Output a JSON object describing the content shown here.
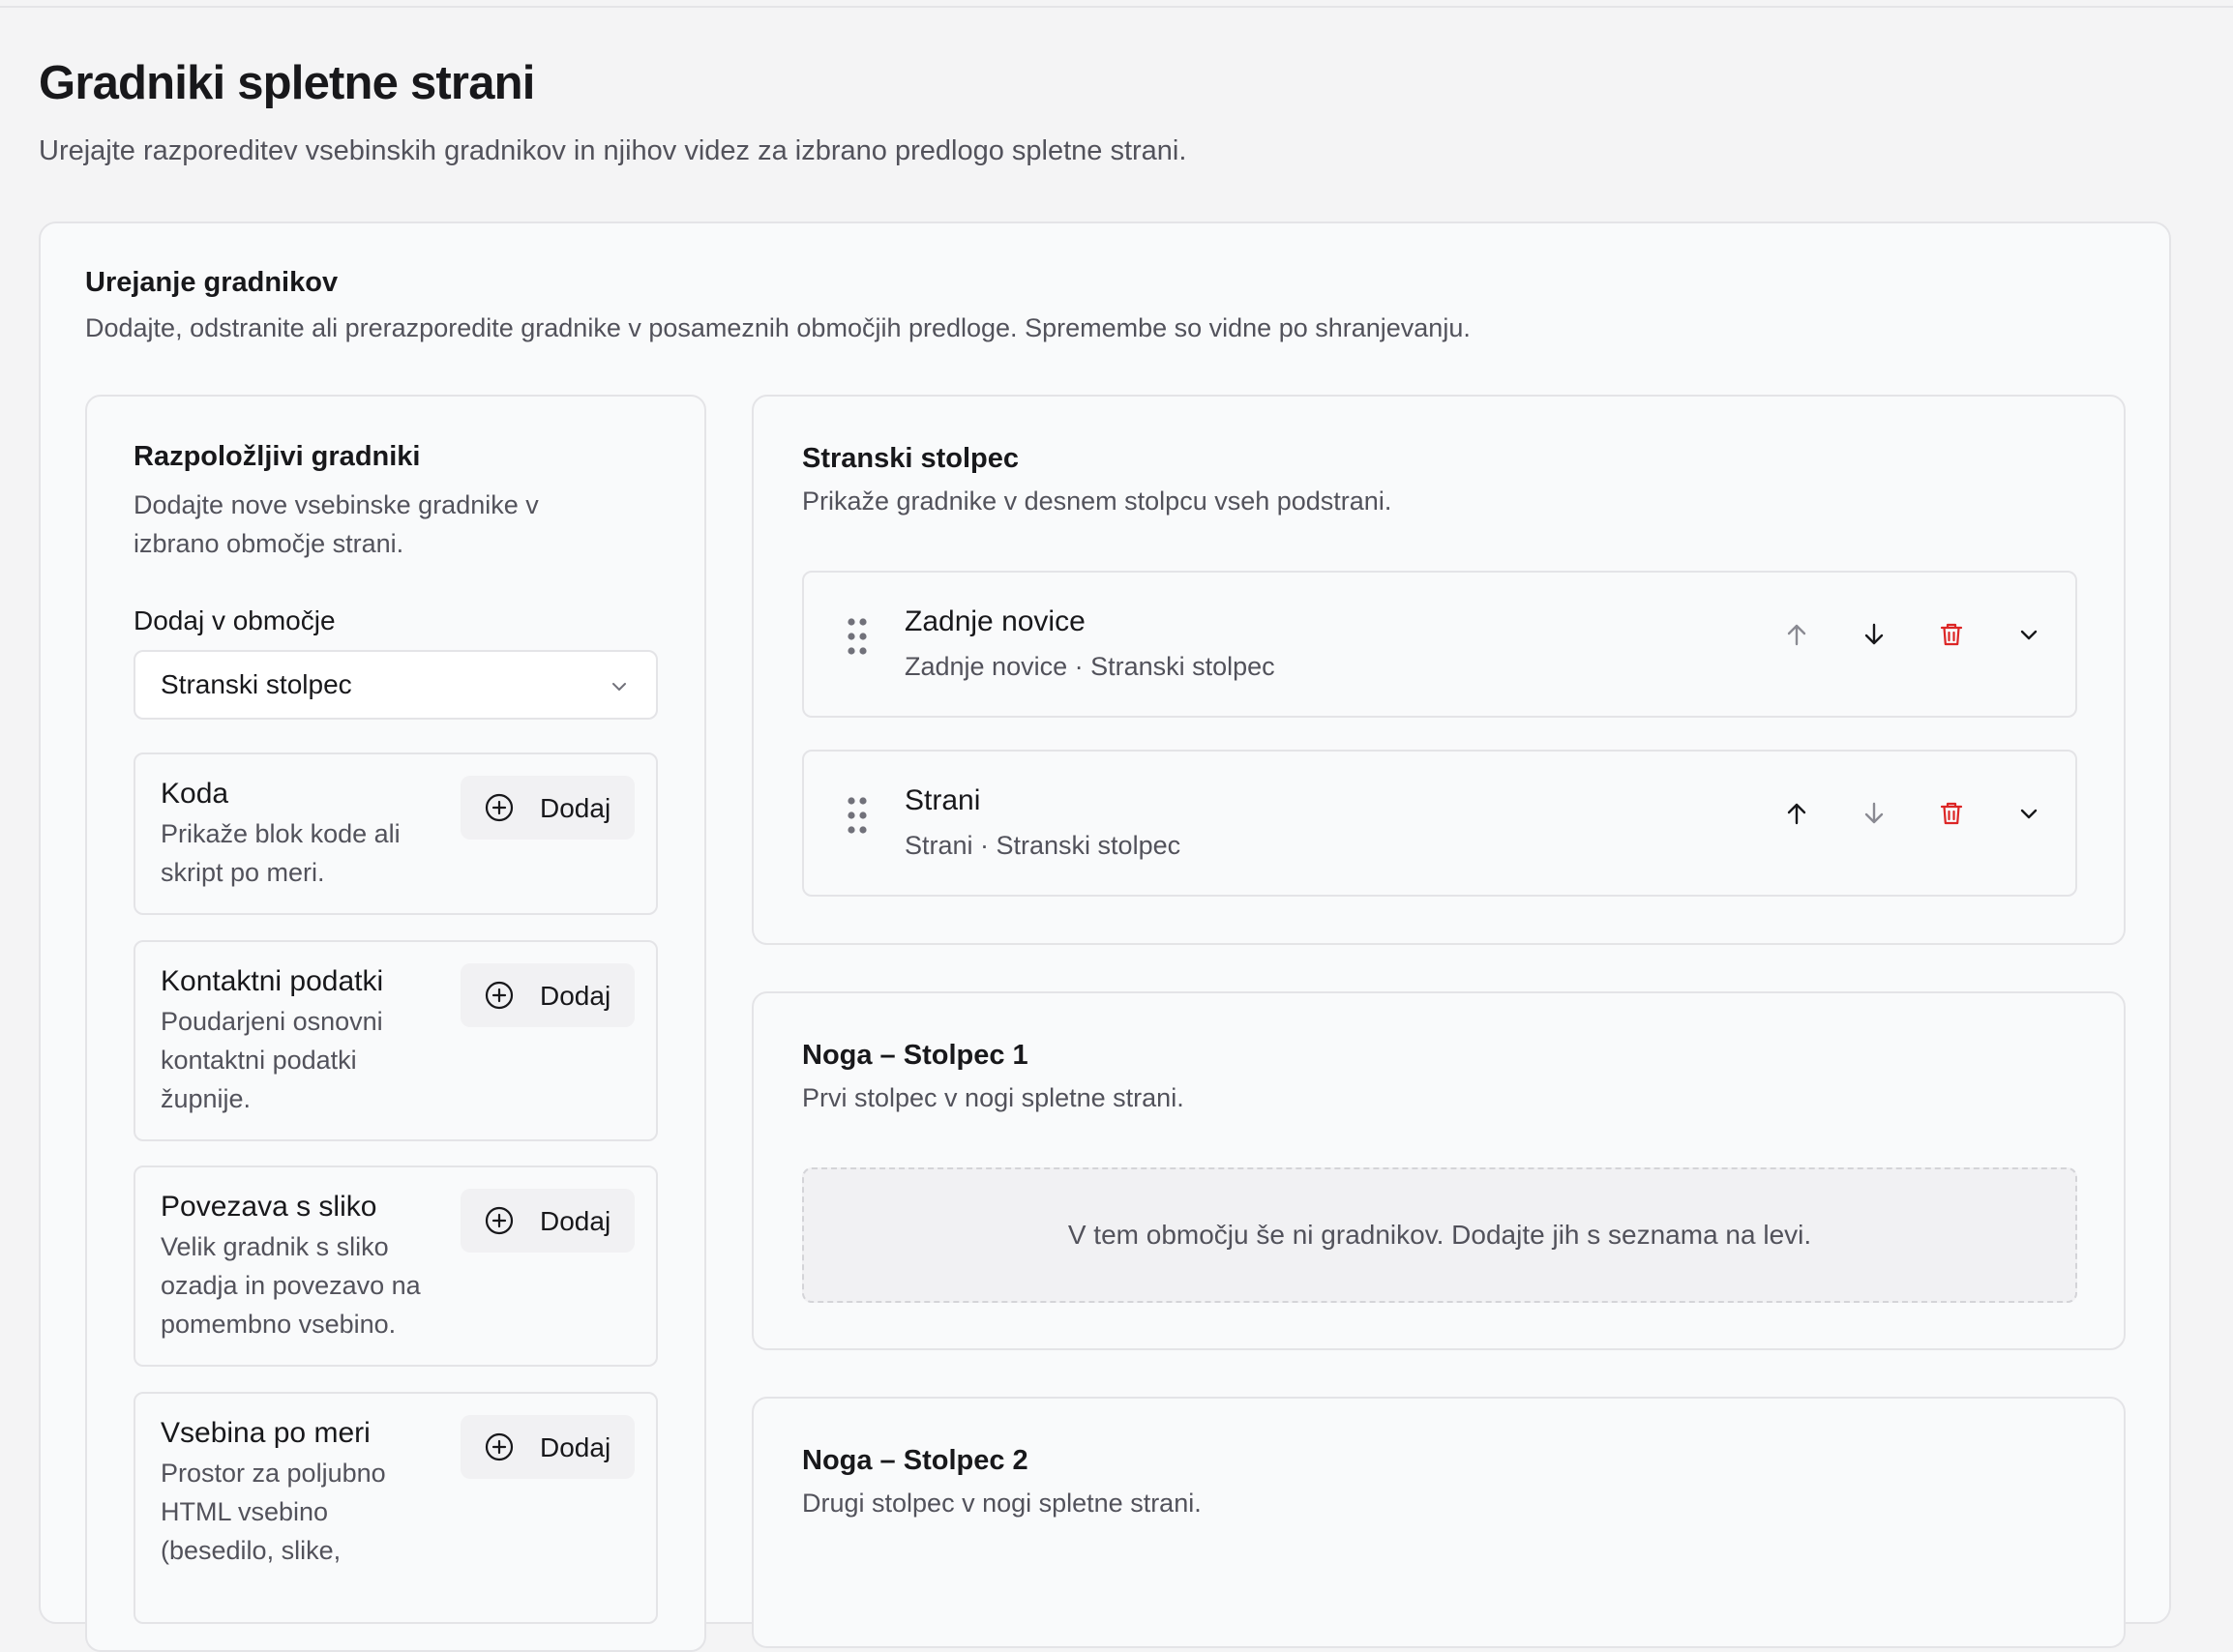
{
  "header": {
    "title": "Gradniki spletne strani",
    "subtitle": "Urejajte razporeditev vsebinskih gradnikov in njihov videz za izbrano predlogo spletne strani."
  },
  "editor": {
    "title": "Urejanje gradnikov",
    "description": "Dodajte, odstranite ali prerazporedite gradnike v posameznih območjih predloge. Spremembe so vidne po shranjevanju."
  },
  "available": {
    "title": "Razpoložljivi gradniki",
    "description": "Dodajte nove vsebinske gradnike v izbrano območje strani.",
    "area_label": "Dodaj v območje",
    "area_selected": "Stranski stolpec",
    "add_label": "Dodaj",
    "widgets": [
      {
        "name": "Koda",
        "description": "Prikaže blok kode ali skript po meri."
      },
      {
        "name": "Kontaktni podatki",
        "description": "Poudarjeni osnovni kontaktni podatki župnije."
      },
      {
        "name": "Povezava s sliko",
        "description": "Velik gradnik s sliko ozadja in povezavo na pomembno vsebino."
      },
      {
        "name": "Vsebina po meri",
        "description": "Prostor za poljubno HTML vsebino (besedilo, slike,"
      }
    ]
  },
  "areas": [
    {
      "title": "Stranski stolpec",
      "description": "Prikaže gradnike v desnem stolpcu vseh podstrani.",
      "items": [
        {
          "title": "Zadnje novice",
          "subtitle": "Zadnje novice · Stranski stolpec"
        },
        {
          "title": "Strani",
          "subtitle": "Strani · Stranski stolpec"
        }
      ]
    },
    {
      "title": "Noga – Stolpec 1",
      "description": "Prvi stolpec v nogi spletne strani.",
      "empty_text": "V tem območju še ni gradnikov. Dodajte jih s seznama na levi."
    },
    {
      "title": "Noga – Stolpec 2",
      "description": "Drugi stolpec v nogi spletne strani."
    }
  ],
  "colors": {
    "page_bg": "#f4f4f5",
    "card_bg": "#f9fafb",
    "border": "#e4e4e7",
    "text": "#18181b",
    "muted": "#52525b",
    "danger": "#dc2626",
    "icon_disabled": "#8a8a92"
  },
  "icons": {
    "select": "chevron-down-icon",
    "add": "plus-circle-icon",
    "drag": "grip-vertical-icon",
    "move_up": "arrow-up-icon",
    "move_down": "arrow-down-icon",
    "delete": "trash-icon",
    "expand": "chevron-down-icon"
  }
}
